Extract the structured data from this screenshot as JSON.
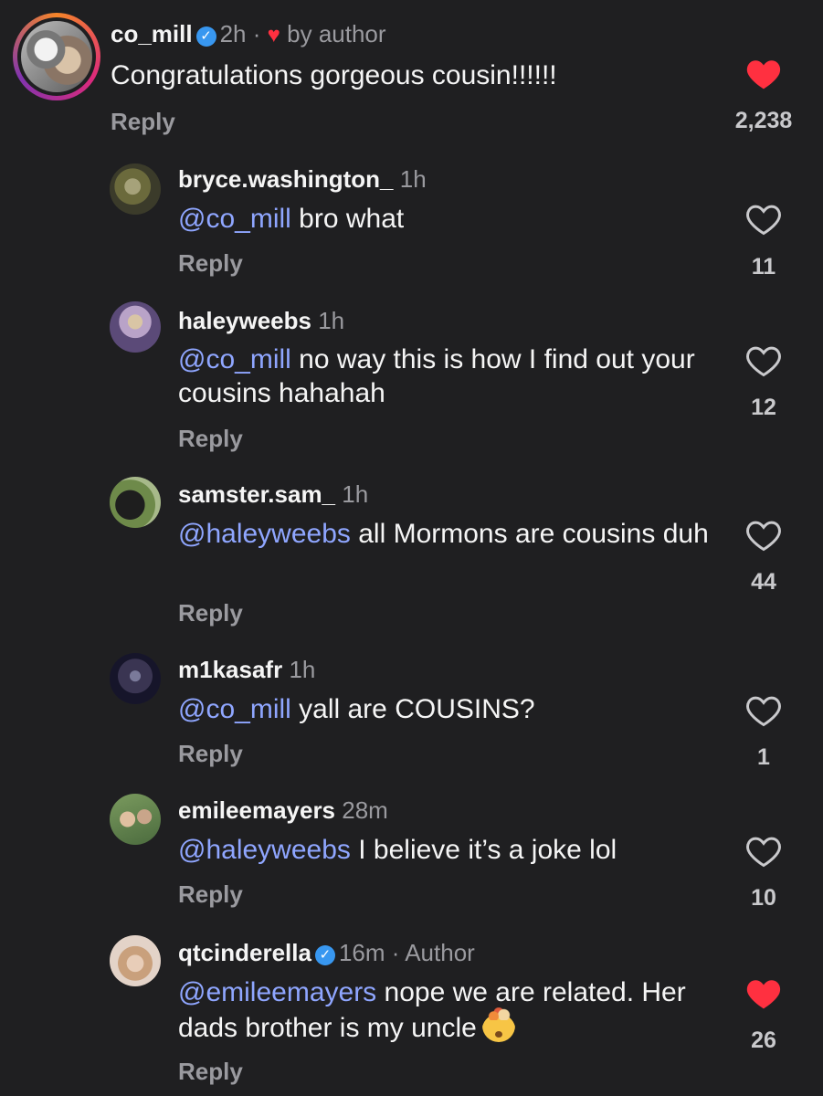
{
  "comments": [
    {
      "user": "co_mill",
      "verified": true,
      "time": "2h",
      "sep": "·",
      "liked_by_author": "by author",
      "mention": "",
      "text": "Congratulations gorgeous cousin!!!!!!",
      "reply": "Reply",
      "likes": "2,238",
      "liked": true,
      "avatar_colors": [
        "#bdbdbd",
        "#5a5a5a"
      ]
    },
    {
      "user": "bryce.washington_",
      "time": "1h",
      "mention": "@co_mill",
      "text": " bro what",
      "reply": "Reply",
      "likes": "11",
      "liked": false,
      "avatar_colors": [
        "#6b6a3c",
        "#3b3b2a"
      ]
    },
    {
      "user": "haleyweebs",
      "time": "1h",
      "mention": "@co_mill",
      "text": " no way this is how I find out your cousins hahahah",
      "reply": "Reply",
      "likes": "12",
      "liked": false,
      "avatar_colors": [
        "#b9a3c8",
        "#5b4a78"
      ]
    },
    {
      "user": "samster.sam_",
      "time": "1h",
      "mention": "@haleyweebs",
      "text": " all Mormons are cousins duh",
      "reply": "Reply",
      "likes": "44",
      "liked": false,
      "avatar_colors": [
        "#6e8a4a",
        "#1e1e1e"
      ]
    },
    {
      "user": "m1kasafr",
      "time": "1h",
      "mention": "@co_mill",
      "text": " yall are COUSINS?",
      "reply": "Reply",
      "likes": "1",
      "liked": false,
      "avatar_colors": [
        "#3a3552",
        "#16152a"
      ]
    },
    {
      "user": "emileemayers",
      "time": "28m",
      "mention": "@haleyweebs",
      "text": " I believe it’s a joke lol",
      "reply": "Reply",
      "likes": "10",
      "liked": false,
      "avatar_colors": [
        "#c9a58a",
        "#4b6b3e"
      ]
    },
    {
      "user": "qtcinderella",
      "verified": true,
      "time": "16m",
      "sep": "·",
      "author_label": "Author",
      "mention": "@emileemayers",
      "text": " nope we are related. Her dads brother is my uncle",
      "emoji": "exploding-head",
      "reply": "Reply",
      "likes": "26",
      "liked": true,
      "avatar_colors": [
        "#e3d3c8",
        "#a8836c"
      ]
    }
  ],
  "colors": {
    "background": "#1f1f21",
    "mention": "#8fa6ff",
    "like_red": "#ff3040",
    "verified_blue": "#3897f0",
    "muted": "#9a9a9f"
  }
}
